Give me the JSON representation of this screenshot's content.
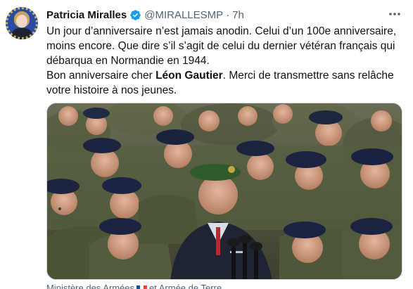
{
  "tweet": {
    "author": {
      "name": "Patricia Miralles",
      "handle": "@MIRALLESMP",
      "separator": "·",
      "time": "7h",
      "verified_color": "#1d9bf0"
    },
    "text": {
      "line1": "Un jour d’anniversaire n’est jamais anodin. Celui d’un 100e anniversaire, moins encore. Que dire s’il s’agit de celui du dernier vétéran français qui débarqua en Normandie en 1944.",
      "line2_prefix": "Bon anniversaire cher ",
      "line2_bold": "Léon Gautier",
      "line2_suffix": ". Merci de transmettre sans relâche votre histoire à nos jeunes."
    },
    "media_credit": {
      "prefix": "Ministère des Armées",
      "suffix": "et Armée de Terre"
    },
    "more_icon": "more-horizontal-icon"
  }
}
